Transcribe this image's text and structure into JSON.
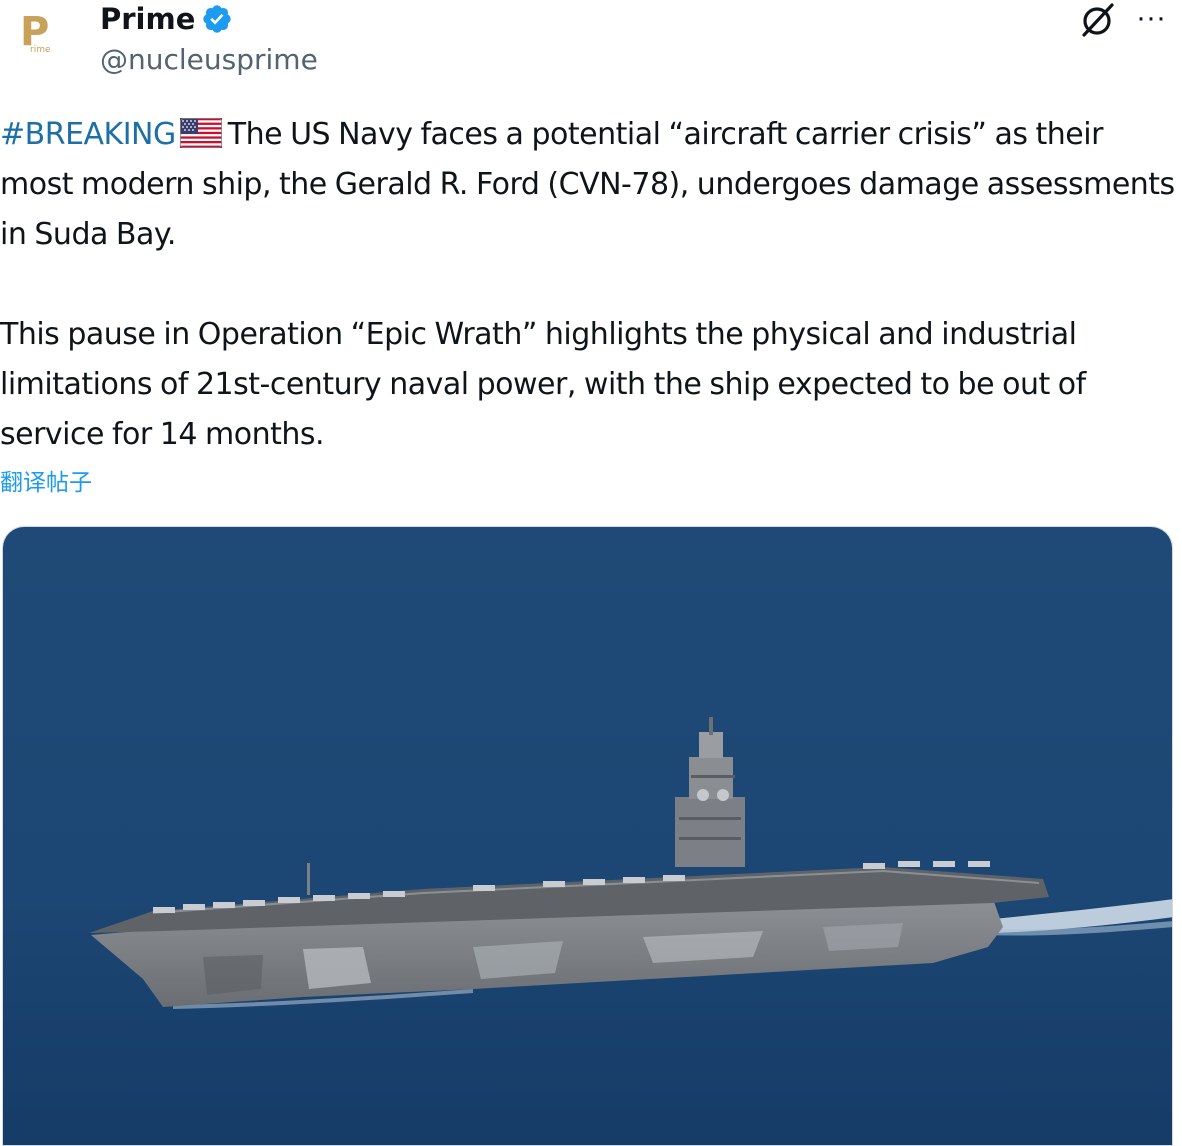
{
  "author": {
    "display_name": "Prime",
    "handle": "@nucleusprime",
    "verified": true,
    "avatar_letter": "P",
    "avatar_sub": "rime"
  },
  "header_icons": {
    "grok": "grok-icon",
    "more": "more-options-icon",
    "more_glyph": "···"
  },
  "tweet": {
    "hashtag": "#BREAKING",
    "flag_icon": "us-flag-icon",
    "paragraph1": "The US Navy faces a potential “aircraft carrier crisis” as their most modern ship, the Gerald R. Ford (CVN-78), undergoes damage assessments in Suda Bay.",
    "paragraph2": "This pause in Operation “Epic Wrath” highlights the physical and industrial limitations of 21st-century naval power, with the ship expected to be out of service for 14 months."
  },
  "translate_label": "翻译帖子",
  "media": {
    "type": "photo",
    "subject": "aircraft-carrier-at-sea",
    "colors": {
      "sea_top": "#1f4a77",
      "sea_bottom": "#173d69",
      "hull": "#7b7f84",
      "deck": "#5d6166"
    }
  },
  "colors": {
    "text": "#0f1419",
    "secondary": "#536471",
    "link": "#1d9bf0",
    "hashtag": "#1d6fa8",
    "verified": "#1d9bf0"
  }
}
